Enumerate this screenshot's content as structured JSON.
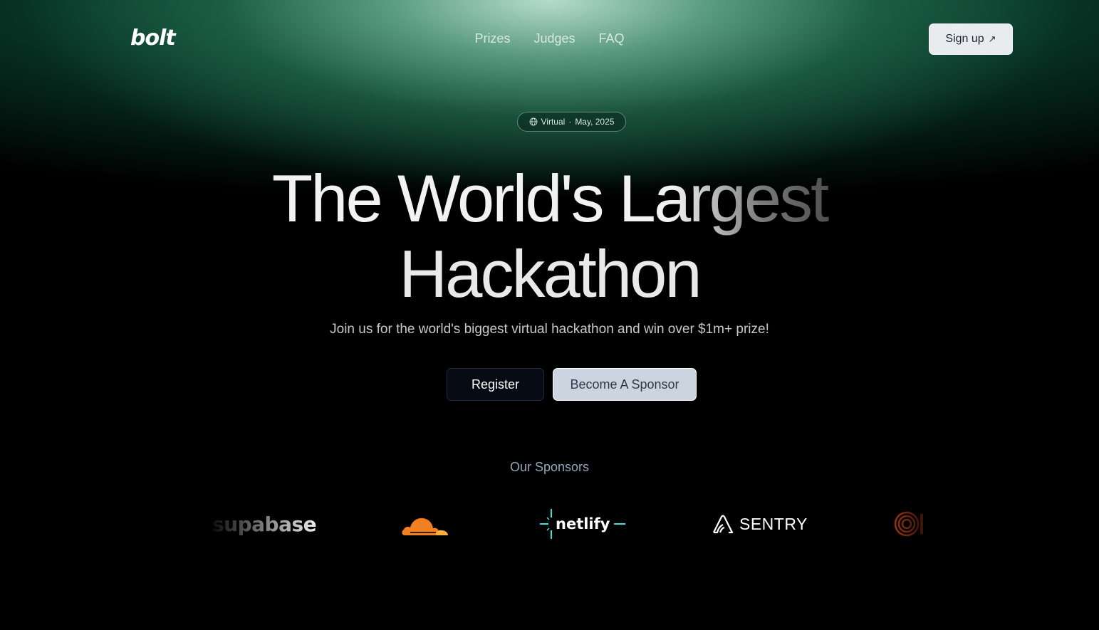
{
  "brand": {
    "logo_text": "bolt"
  },
  "nav": {
    "links": [
      "Prizes",
      "Judges",
      "FAQ"
    ],
    "signup_label": "Sign up"
  },
  "hero": {
    "badge": {
      "icon": "globe-icon",
      "location": "Virtual",
      "separator": "·",
      "date": "May, 2025"
    },
    "headline_line1": "The World's Largest",
    "headline_line2": "Hackathon",
    "subtitle": "Join us for the world's biggest virtual hackathon and win over $1m+ prize!",
    "primary_button": "Register",
    "secondary_button": "Become A Sponsor"
  },
  "sponsors": {
    "title": "Our Sponsors",
    "items": [
      {
        "name": "supabase",
        "icon": "supabase-logo"
      },
      {
        "name": "Cloudflare",
        "icon": "cloudflare-cloud-icon",
        "color": "#f38020"
      },
      {
        "name": "netlify",
        "icon": "netlify-logo",
        "color": "#32e6e2"
      },
      {
        "name": "SENTRY",
        "icon": "sentry-icon"
      },
      {
        "name": "",
        "icon": "concentric-circle-logo",
        "color": "#c2421b"
      }
    ]
  },
  "colors": {
    "background": "#000000",
    "glow_green": "#1e6e50",
    "sponsor_title": "#93a7bd",
    "sponsor_button_bg": "#ccd5df"
  }
}
